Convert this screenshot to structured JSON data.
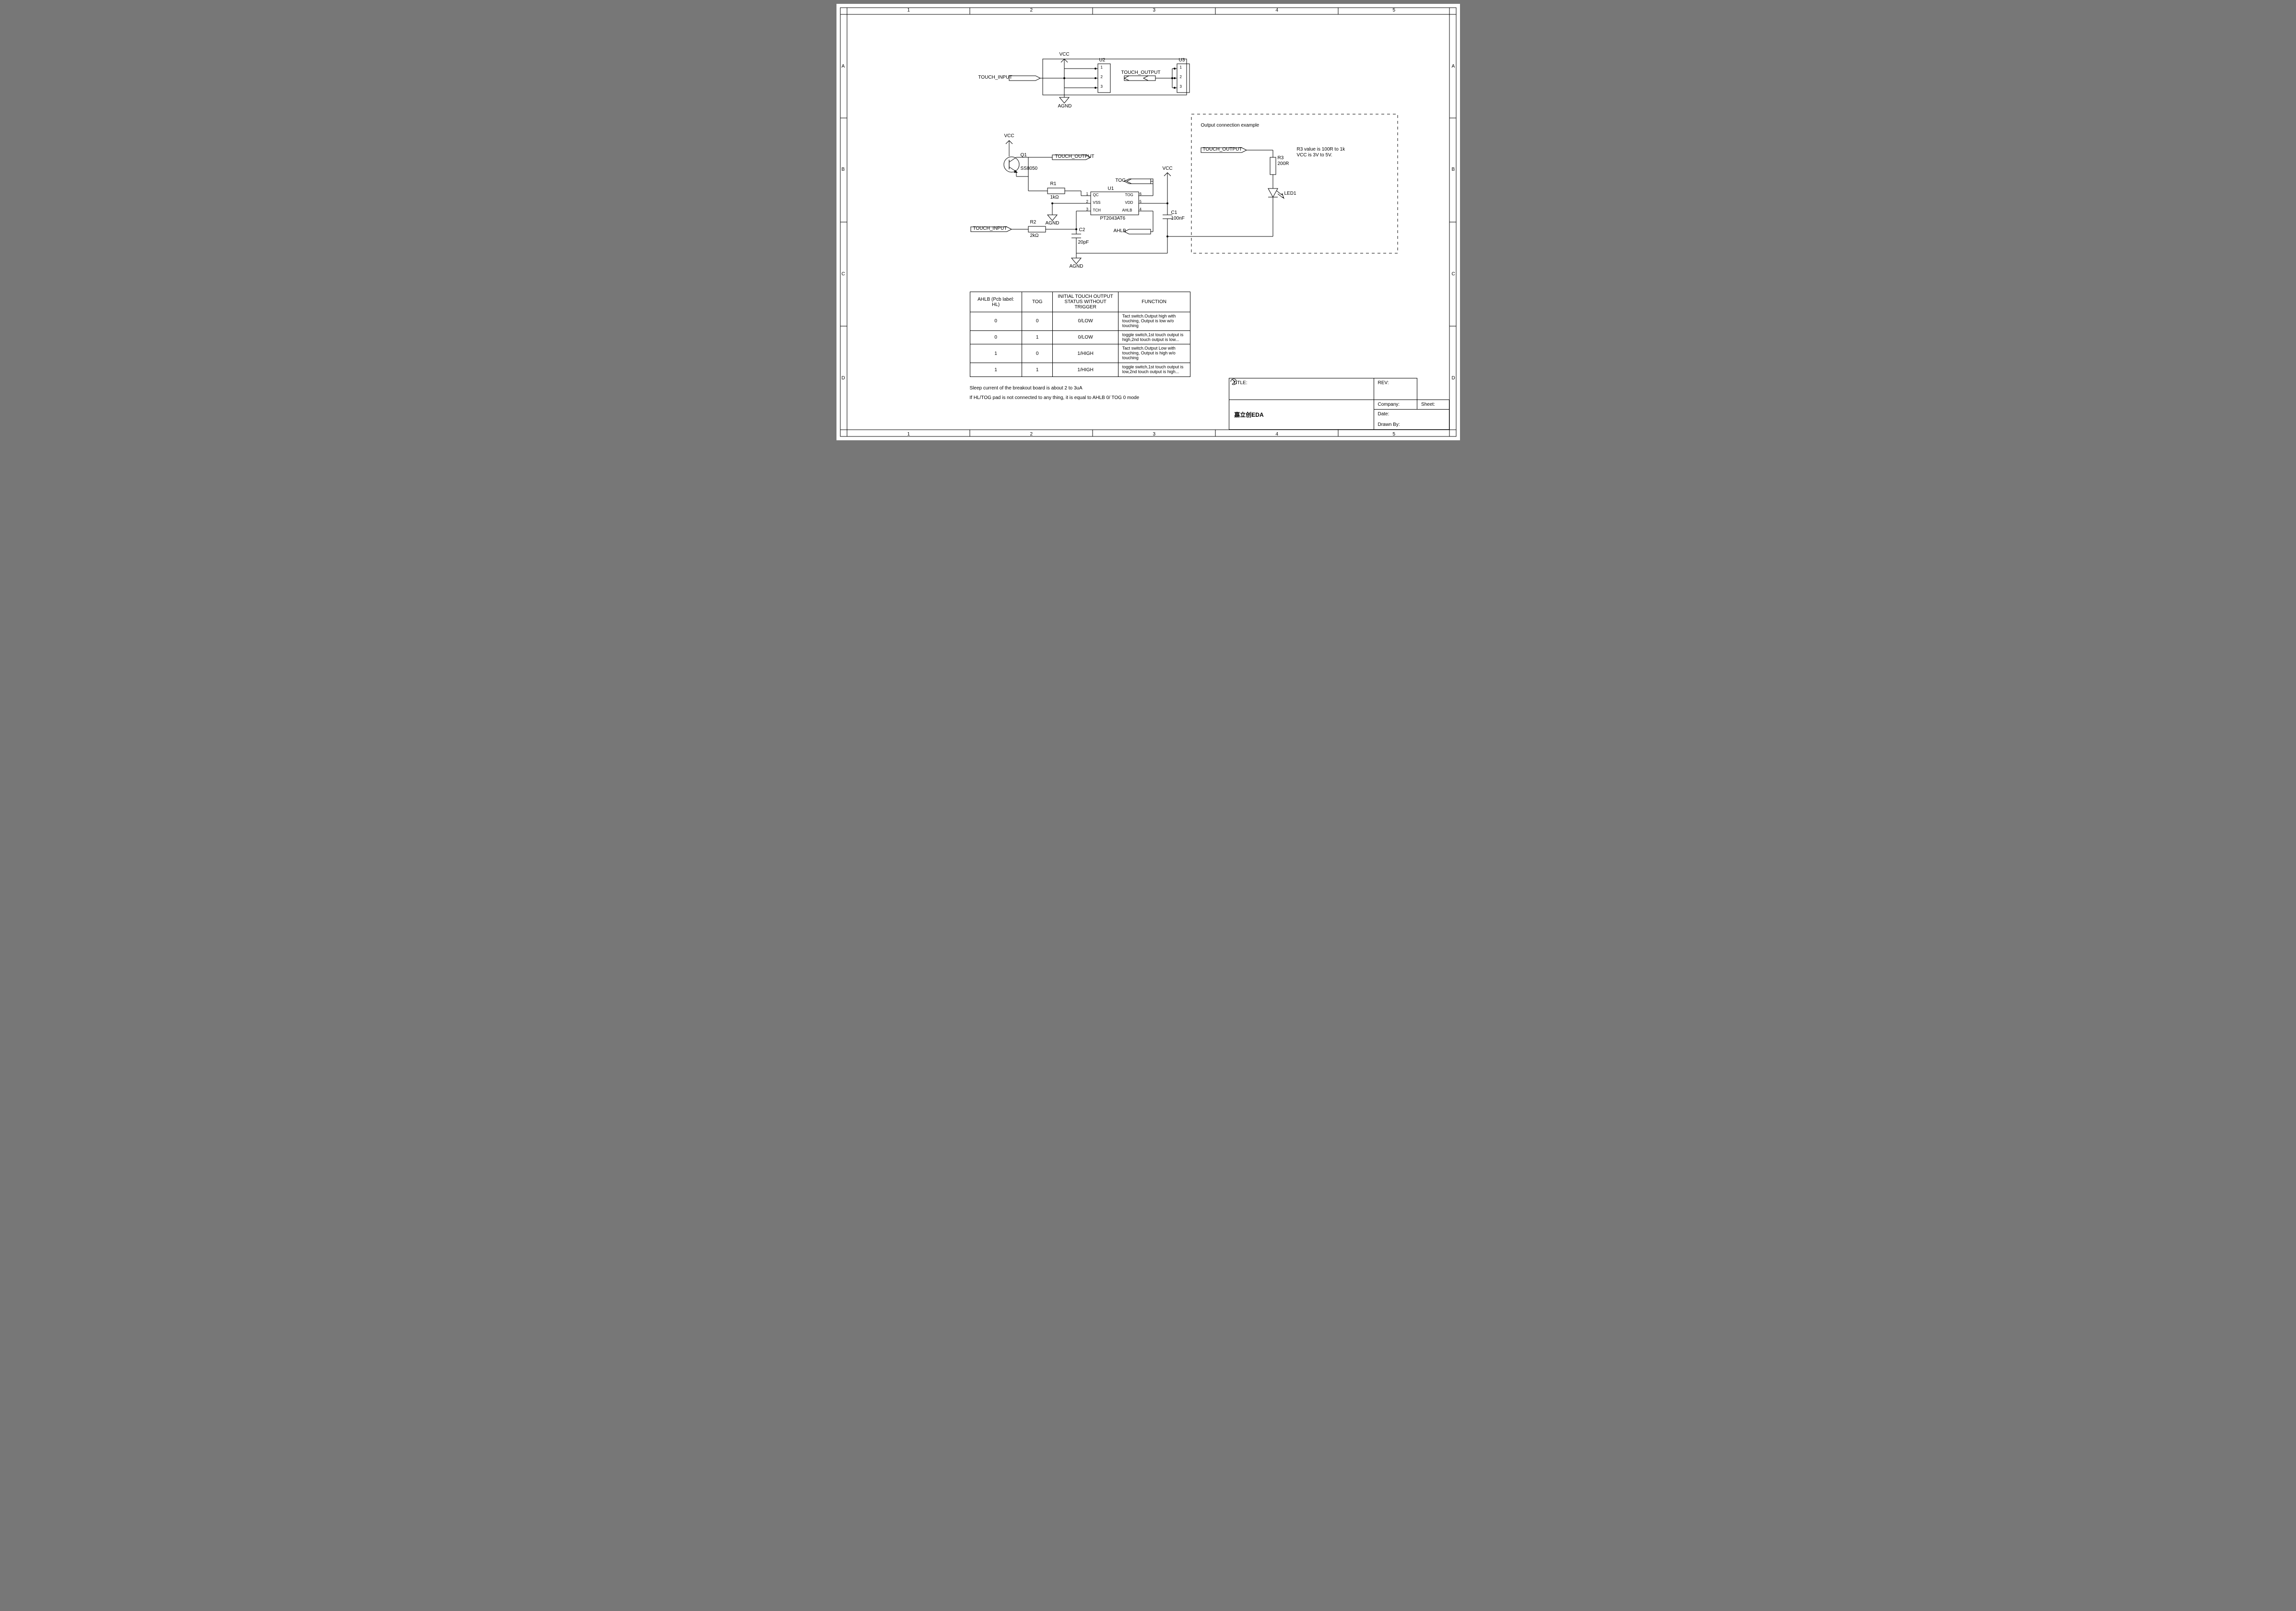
{
  "ruler": {
    "cols": [
      "1",
      "2",
      "3",
      "4",
      "5"
    ],
    "rows": [
      "A",
      "B",
      "C",
      "D"
    ]
  },
  "top_section": {
    "touch_input_label": "TOUCH_INPUT",
    "touch_output_label": "TOUCH_OUTPUT",
    "vcc_label": "VCC",
    "agnd_label": "AGND",
    "u2": {
      "ref": "U2",
      "pins": [
        "1",
        "2",
        "3"
      ]
    },
    "u3": {
      "ref": "U3",
      "pins": [
        "1",
        "2",
        "3"
      ]
    }
  },
  "main_section": {
    "q1": {
      "ref": "Q1",
      "part": "SS8050"
    },
    "r1": {
      "ref": "R1",
      "value": "1kΩ"
    },
    "r2": {
      "ref": "R2",
      "value": "2kΩ"
    },
    "c1": {
      "ref": "C1",
      "value": "100nF"
    },
    "c2": {
      "ref": "C2",
      "value": "20pF"
    },
    "u1": {
      "ref": "U1",
      "part": "PT2043AT6",
      "left_pins": [
        {
          "n": "1",
          "name": "QC"
        },
        {
          "n": "2",
          "name": "VSS"
        },
        {
          "n": "3",
          "name": "TCH"
        }
      ],
      "right_pins": [
        {
          "n": "6",
          "name": "TOG"
        },
        {
          "n": "5",
          "name": "VDD"
        },
        {
          "n": "4",
          "name": "AHLB"
        }
      ]
    },
    "nets": {
      "vcc": "VCC",
      "agnd": "AGND",
      "touch_input": "TOUCH_INPUT",
      "touch_output": "TOUCH_OUTPUT",
      "tog": "TOG",
      "ahlb": "AHLB"
    }
  },
  "example_section": {
    "title": "Output connection example",
    "touch_output_label": "TOUCH_OUTPUT",
    "r3": {
      "ref": "R3",
      "value": "200R"
    },
    "led1": {
      "ref": "LED1"
    },
    "note_line1": "R3 value is 100R to 1k",
    "note_line2": "VCC is 3V to 5V."
  },
  "mode_table": {
    "headers": [
      "AHLB (Pcb label: HL)",
      "TOG",
      "INITIAL TOUCH OUTPUT STATUS WITHOUT TRIGGER",
      "FUNCTION"
    ],
    "rows": [
      {
        "ahlb": "0",
        "tog": "0",
        "status": "0/LOW",
        "func": "Tact switch.Output high with touching,\nOutput is low w/o touching"
      },
      {
        "ahlb": "0",
        "tog": "1",
        "status": "0/LOW",
        "func": "toggle switch,1st touch output is high,2nd touch output is low..."
      },
      {
        "ahlb": "1",
        "tog": "0",
        "status": "1/HIGH",
        "func": "Tact switch.Output Low with touching,\nOutput is high w/o touching"
      },
      {
        "ahlb": "1",
        "tog": "1",
        "status": "1/HIGH",
        "func": "toggle switch,1st touch output is low,2nd touch output is high..."
      }
    ]
  },
  "notes": {
    "n1": "Sleep current of the breakout board is about 2 to 3uA",
    "n2": "If HL/TOG pad is not connected to any thing, it is equal to AHLB 0/ TOG 0 mode"
  },
  "titleblock": {
    "title_label": "TITLE:",
    "rev_label": "REV:",
    "company_label": "Company:",
    "sheet_label": "Sheet:",
    "date_label": "Date:",
    "drawn_label": "Drawn By:",
    "logo_text": "嘉立创EDA"
  }
}
